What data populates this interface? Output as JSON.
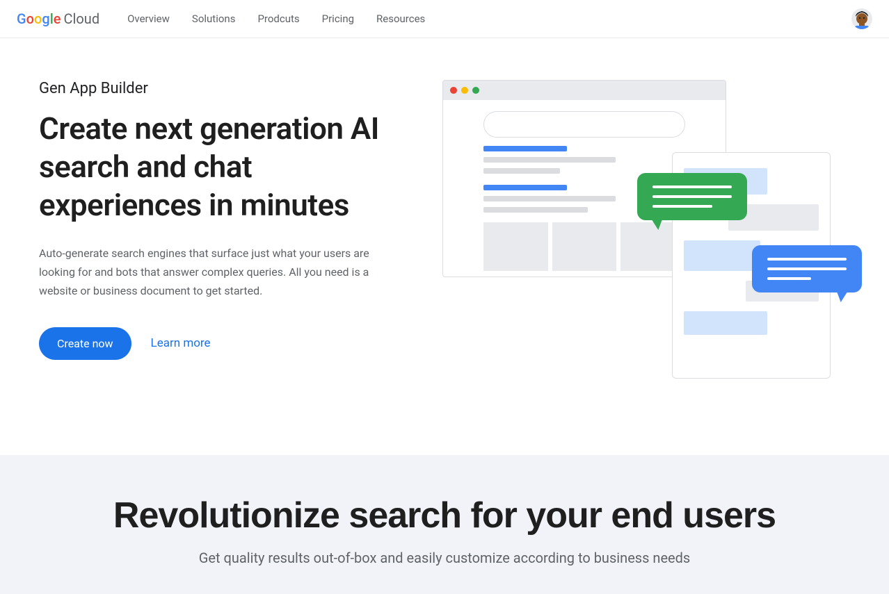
{
  "header": {
    "brand_word": "Google",
    "brand_suffix": "Cloud",
    "nav": [
      "Overview",
      "Solutions",
      "Prodcuts",
      "Pricing",
      "Resources"
    ]
  },
  "hero": {
    "eyebrow": "Gen App Builder",
    "title": "Create next generation AI search and chat experiences in minutes",
    "description": "Auto-generate search engines that surface just what your users are looking for and bots that answer complex queries. All you need is a website or business document to get started.",
    "primary_cta": "Create now",
    "secondary_cta": "Learn more"
  },
  "section2": {
    "title": "Revolutionize search for your end users",
    "subtitle": "Get quality results out-of-box and easily customize according to business needs"
  }
}
